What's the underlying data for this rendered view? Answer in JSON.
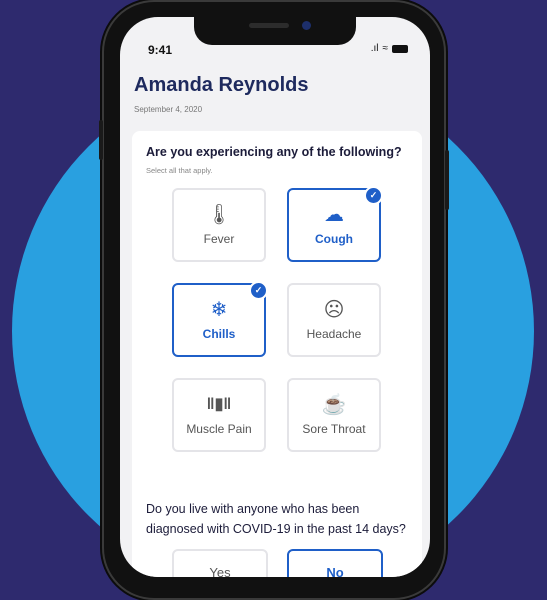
{
  "status_bar": {
    "time": "9:41",
    "signal": ".ıl",
    "wifi": "≈"
  },
  "user": {
    "name": "Amanda Reynolds",
    "date": "September 4, 2020"
  },
  "question1": {
    "title": "Are you experiencing any of the following?",
    "subtitle": "Select all that apply.",
    "options": [
      {
        "label": "Fever",
        "icon": "thermometer-icon",
        "glyph": "🌡",
        "selected": false
      },
      {
        "label": "Cough",
        "icon": "cough-icon",
        "glyph": "☁",
        "selected": true
      },
      {
        "label": "Chills",
        "icon": "snowflake-icon",
        "glyph": "❄",
        "selected": true
      },
      {
        "label": "Headache",
        "icon": "sad-face-icon",
        "glyph": "☹",
        "selected": false
      },
      {
        "label": "Muscle Pain",
        "icon": "dumbbell-icon",
        "glyph": "‖▮‖",
        "selected": false
      },
      {
        "label": "Sore Throat",
        "icon": "hot-drink-icon",
        "glyph": "☕",
        "selected": false
      }
    ]
  },
  "question2": {
    "title": "Do you live with anyone who has been diagnosed with COVID-19 in the past 14 days?",
    "answers": [
      {
        "label": "Yes",
        "selected": false
      },
      {
        "label": "No",
        "selected": true
      }
    ]
  },
  "colors": {
    "background": "#2e2a6e",
    "circle": "#29a0e0",
    "accent": "#1f5fc8",
    "title": "#1e2a5e"
  }
}
